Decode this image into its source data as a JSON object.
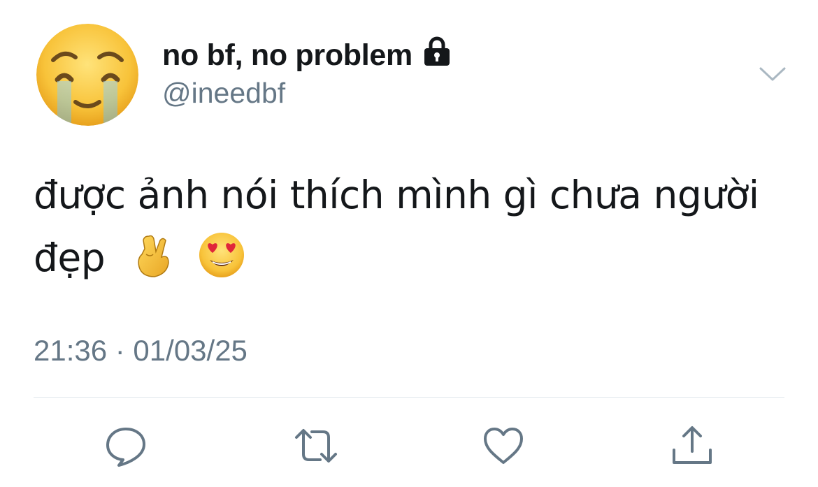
{
  "user": {
    "display_name": "no bf, no problem",
    "handle": "@ineedbf",
    "avatar_icon": "crying-face-emoji",
    "protected_icon": "lock-icon"
  },
  "tweet": {
    "line1": "được ảnh nói thích mình gì chưa người",
    "line2": "đẹp",
    "emojis": [
      "crossed-fingers-emoji",
      "heart-eyes-emoji"
    ],
    "timestamp": "21:36 · 01/03/25"
  },
  "actions": [
    {
      "name": "reply-icon"
    },
    {
      "name": "retweet-icon"
    },
    {
      "name": "like-icon"
    },
    {
      "name": "share-icon"
    }
  ],
  "colors": {
    "text": "#14171a",
    "muted": "#657786",
    "divider": "#e1e8ed"
  }
}
